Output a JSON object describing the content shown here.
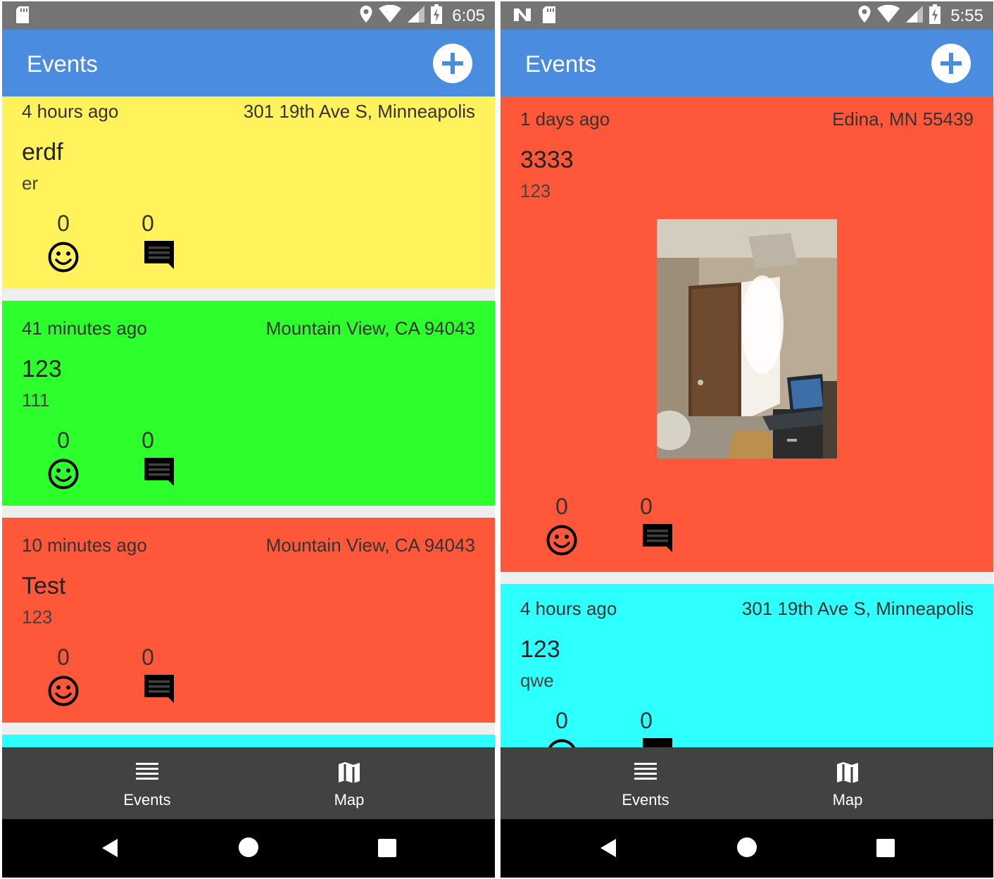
{
  "phones": [
    {
      "status": {
        "time": "6:05"
      },
      "app_bar": {
        "title": "Events"
      },
      "events": [
        {
          "time_ago": "4 hours ago",
          "location": "301 19th Ave S,  Minneapolis",
          "title": "erdf",
          "description": "er",
          "reactions": "0",
          "comments": "0",
          "color": "#fff25b"
        },
        {
          "time_ago": "41 minutes ago",
          "location": "Mountain View,  CA 94043",
          "title": "123",
          "description": "111",
          "reactions": "0",
          "comments": "0",
          "color": "#2cff2c"
        },
        {
          "time_ago": "10 minutes ago",
          "location": "Mountain View,  CA 94043",
          "title": "Test",
          "description": "123",
          "reactions": "0",
          "comments": "0",
          "color": "#ff573a"
        }
      ],
      "partial_card_color": "#2effff",
      "bottom_nav": [
        {
          "label": "Events",
          "icon": "list-icon"
        },
        {
          "label": "Map",
          "icon": "map-icon"
        }
      ]
    },
    {
      "status": {
        "time": "5:55"
      },
      "app_bar": {
        "title": "Events"
      },
      "events": [
        {
          "time_ago": "1 days ago",
          "location": "Edina,  MN 55439",
          "title": "3333",
          "description": "123",
          "reactions": "0",
          "comments": "0",
          "color": "#ff573a",
          "has_photo": true
        },
        {
          "time_ago": "4 hours ago",
          "location": "301 19th Ave S,  Minneapolis",
          "title": "123",
          "description": "qwe",
          "reactions": "0",
          "comments": "0",
          "color": "#2effff"
        }
      ],
      "bottom_nav": [
        {
          "label": "Events",
          "icon": "list-icon"
        },
        {
          "label": "Map",
          "icon": "map-icon"
        }
      ]
    }
  ],
  "colors": {
    "app_bar": "#4a8de0",
    "status_bar": "#757575",
    "bottom_nav": "#424242",
    "system_nav": "#000000"
  }
}
